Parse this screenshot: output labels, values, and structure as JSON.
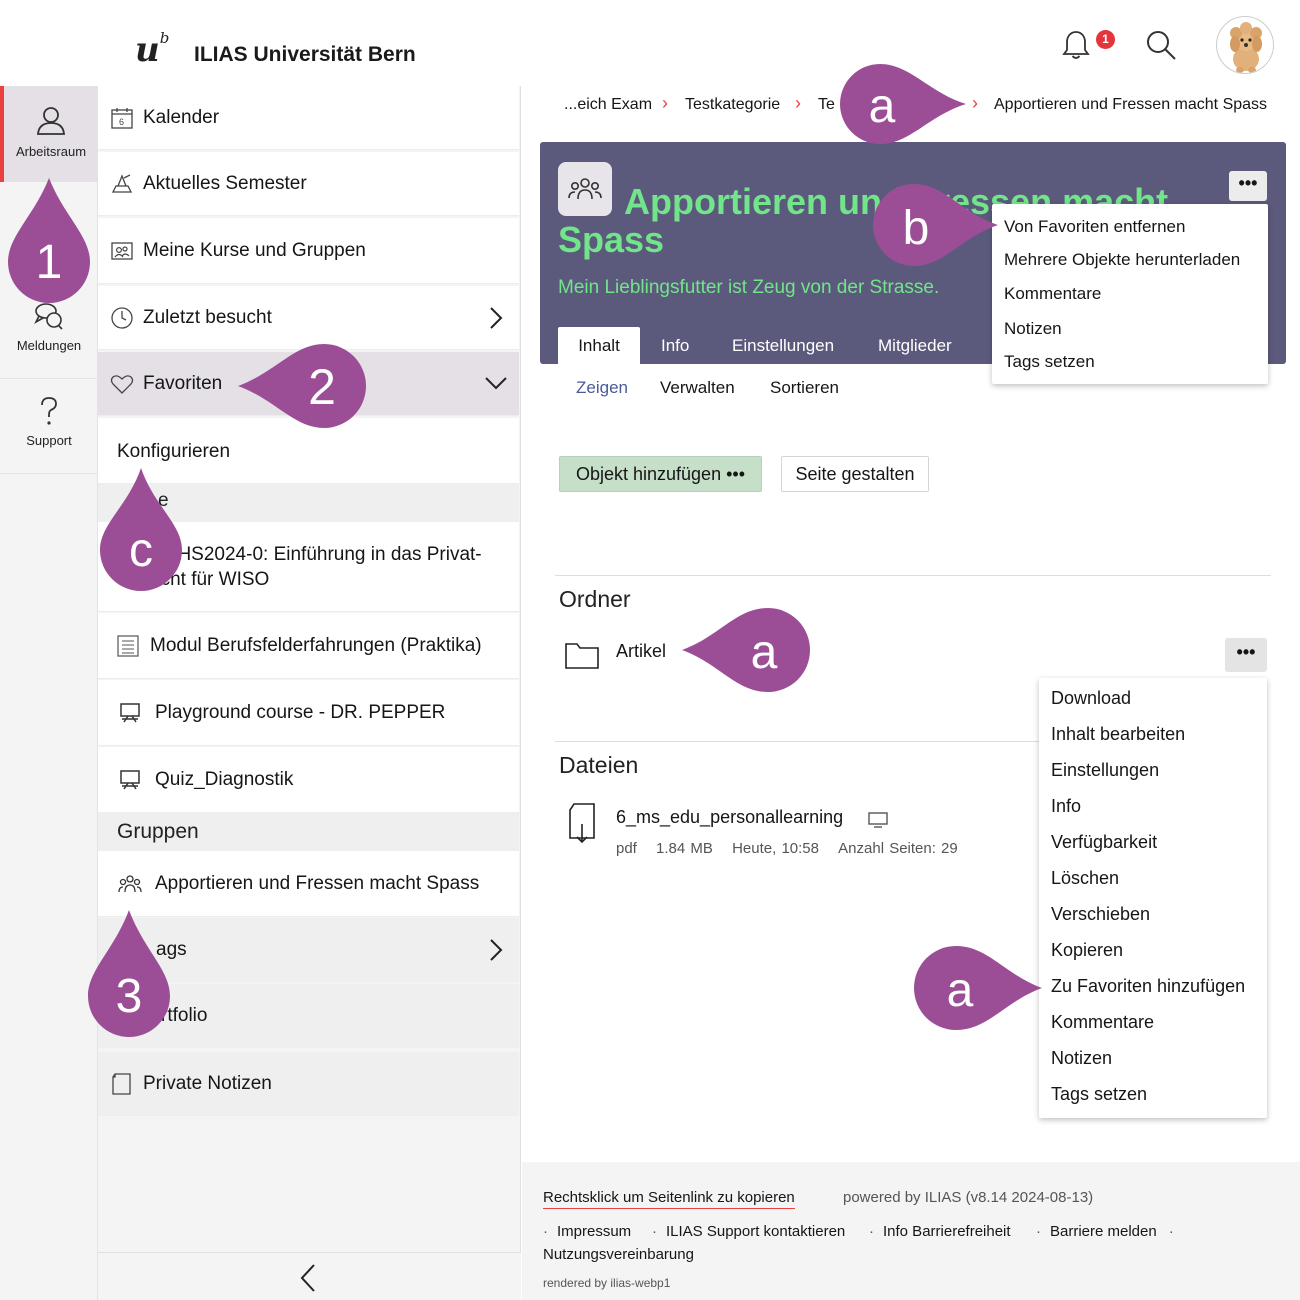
{
  "header": {
    "logo_text": "u",
    "logo_sup": "b",
    "brand": "ILIAS Universität Bern",
    "notification_count": "1"
  },
  "mainbar": {
    "items": [
      {
        "label": "Arbeitsraum",
        "icon": "user-icon"
      },
      {
        "label": "Meldungen",
        "icon": "chat-icon"
      },
      {
        "label": "Support",
        "icon": "question-icon"
      }
    ]
  },
  "slate": {
    "items": [
      {
        "label": "Kalender",
        "icon": "calendar-icon"
      },
      {
        "label": "Aktuelles Semester",
        "icon": "semester-icon"
      },
      {
        "label": "Meine Kurse und Gruppen",
        "icon": "courses-icon"
      },
      {
        "label": "Zuletzt besucht",
        "icon": "clock-icon"
      },
      {
        "label": "Favoriten",
        "icon": "heart-icon"
      }
    ],
    "konfigurieren": "Konfigurieren",
    "kurse_head_partial": "e",
    "course1_line1": "55-HS2024-0: Einführung in das Privat-",
    "course1_line2": "echt für WISO",
    "course2": "Modul Berufsfelderfahrungen (Praktika)",
    "course3": "Playground course - DR. PEPPER",
    "course4": "Quiz_Diagnostik",
    "gruppen_head": "Gruppen",
    "group1": "Apportieren und Fressen macht Spass",
    "tags": "ags",
    "portfolio": "rtfolio",
    "notizen": "Private Notizen"
  },
  "breadcrumb": {
    "items": [
      "...eich Exam",
      "Testkategorie",
      "Te",
      "Apportieren und Fressen macht Spass"
    ]
  },
  "hero": {
    "title": "Apportieren und Fressen macht Spass",
    "description": "Mein Lieblingsfutter ist Zeug von der Strasse.",
    "tabs": [
      "Inhalt",
      "Info",
      "Einstellungen",
      "Mitglieder"
    ],
    "more": "•••",
    "dropdown": [
      "Von Favoriten entfernen",
      "Mehrere Objekte herunterladen",
      "Kommentare",
      "Notizen",
      "Tags setzen"
    ]
  },
  "subtabs": [
    "Zeigen",
    "Verwalten",
    "Sortieren"
  ],
  "toolbar": {
    "add_label": "Objekt hinzufügen •••",
    "seite_label": "Seite gestalten"
  },
  "ordner": {
    "heading": "Ordner",
    "item": "Artikel",
    "more": "•••",
    "dropdown": [
      "Download",
      "Inhalt bearbeiten",
      "Einstellungen",
      "Info",
      "Verfügbarkeit",
      "Löschen",
      "Verschieben",
      "Kopieren",
      "Zu Favoriten hinzufügen",
      "Kommentare",
      "Notizen",
      "Tags setzen"
    ]
  },
  "dateien": {
    "heading": "Dateien",
    "name": "6_ms_edu_personallearning",
    "type": "pdf",
    "size": "1.84 MB",
    "date": "Heute, 10:58",
    "pages": "Anzahl Seiten: 29"
  },
  "footer": {
    "permalink": "Rechtsklick um Seitenlink zu kopieren",
    "powered": "powered by ILIAS (v8.14 2024-08-13)",
    "links": [
      "Impressum",
      "ILIAS Support kontaktieren",
      "Info Barrierefreiheit",
      "Barriere melden"
    ],
    "nutzung": "Nutzungsvereinbarung",
    "rendered": "rendered by ilias-webp1"
  },
  "annotations": {
    "markers": [
      "1",
      "2",
      "3",
      "a",
      "b",
      "c",
      "a",
      "a"
    ],
    "color": "#9b4e96"
  }
}
